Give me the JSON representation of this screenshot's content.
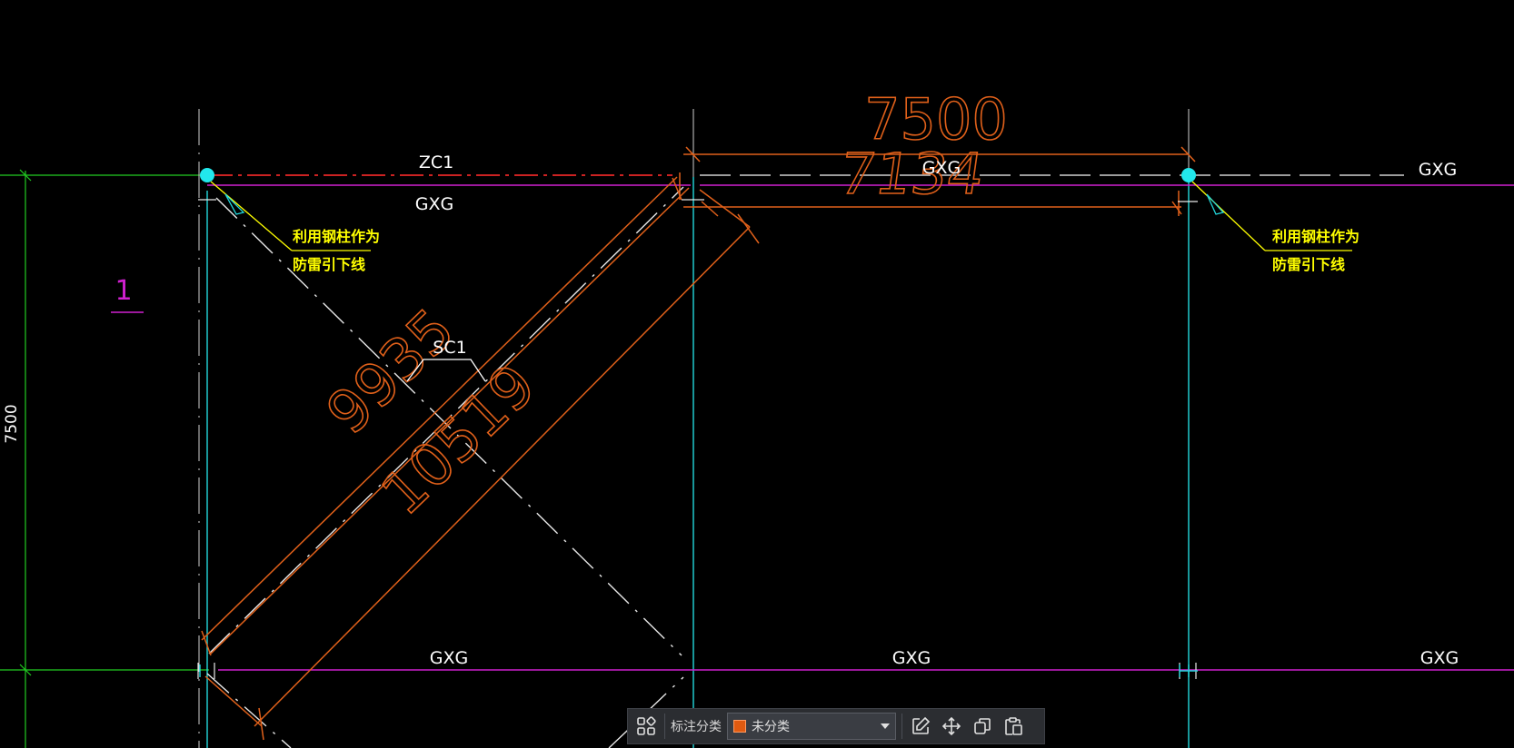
{
  "drawing": {
    "dim_top_total": "7500",
    "dim_top_inner": "7134",
    "dim_diag_inner": "9935",
    "dim_diag_outer": "10519",
    "dim_left_vertical": "7500",
    "grid_marker": "1",
    "label_zc1": "ZC1",
    "label_sc1": "SC1",
    "label_gxg_top_left": "GXG",
    "label_gxg_top_mid": "GXG",
    "label_gxg_top_right": "GXG",
    "label_gxg_bottom_left": "GXG",
    "label_gxg_bottom_mid": "GXG",
    "label_gxg_bottom_right": "GXG",
    "note_left_line1": "利用钢柱作为",
    "note_left_line2": "防雷引下线",
    "note_right_line1": "利用钢柱作为",
    "note_right_line2": "防雷引下线"
  },
  "colors": {
    "background": "#000000",
    "dimension": "#e0601a",
    "axis_cyan": "#22d8dc",
    "beam_magenta": "#d020d0",
    "grid_green": "#22cc22",
    "note_yellow": "#ffff00",
    "centerline_white": "#ffffff",
    "dashed_red": "#cc2222"
  },
  "toolbar": {
    "grid_icon": "apps-grid-icon",
    "classify_label": "标注分类",
    "select_value": "未分类",
    "select_swatch_color": "#e05a10",
    "edit_icon": "edit-icon",
    "move_icon": "move-icon",
    "copy_icon": "copy-icon",
    "paste_icon": "paste-icon"
  }
}
